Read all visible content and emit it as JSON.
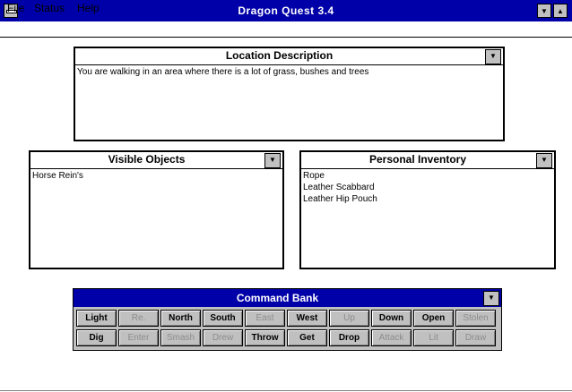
{
  "window": {
    "title": "Dragon Quest 3.4",
    "minimize_glyph": "▼",
    "maximize_glyph": "▲"
  },
  "menu": [
    "File",
    "Status",
    "Help"
  ],
  "location": {
    "title": "Location Description",
    "text": "You are walking in an area where there is a lot of grass, bushes and trees"
  },
  "visible": {
    "title": "Visible Objects",
    "items": [
      "Horse Rein's"
    ]
  },
  "inventory": {
    "title": "Personal Inventory",
    "items": [
      "Rope",
      "Leather Scabbard",
      "Leather Hip Pouch"
    ]
  },
  "dropdown_glyph": "▼",
  "command_bank": {
    "title": "Command Bank",
    "buttons": [
      {
        "label": "Light",
        "enabled": true
      },
      {
        "label": "Re.",
        "enabled": false
      },
      {
        "label": "North",
        "enabled": true
      },
      {
        "label": "South",
        "enabled": true
      },
      {
        "label": "East",
        "enabled": false
      },
      {
        "label": "West",
        "enabled": true
      },
      {
        "label": "Up",
        "enabled": false
      },
      {
        "label": "Down",
        "enabled": true
      },
      {
        "label": "Open",
        "enabled": true
      },
      {
        "label": "Stolen",
        "enabled": false
      },
      {
        "label": "Dig",
        "enabled": true
      },
      {
        "label": "Enter",
        "enabled": false
      },
      {
        "label": "Smash",
        "enabled": false
      },
      {
        "label": "Drew",
        "enabled": false
      },
      {
        "label": "Throw",
        "enabled": true
      },
      {
        "label": "Get",
        "enabled": true
      },
      {
        "label": "Drop",
        "enabled": true
      },
      {
        "label": "Attack",
        "enabled": false
      },
      {
        "label": "Lit",
        "enabled": false
      },
      {
        "label": "Draw",
        "enabled": false
      }
    ]
  },
  "colors": {
    "title_bar": "#0000a8",
    "button_face": "#c0c0c0",
    "disabled_text": "#8c8c8c"
  }
}
